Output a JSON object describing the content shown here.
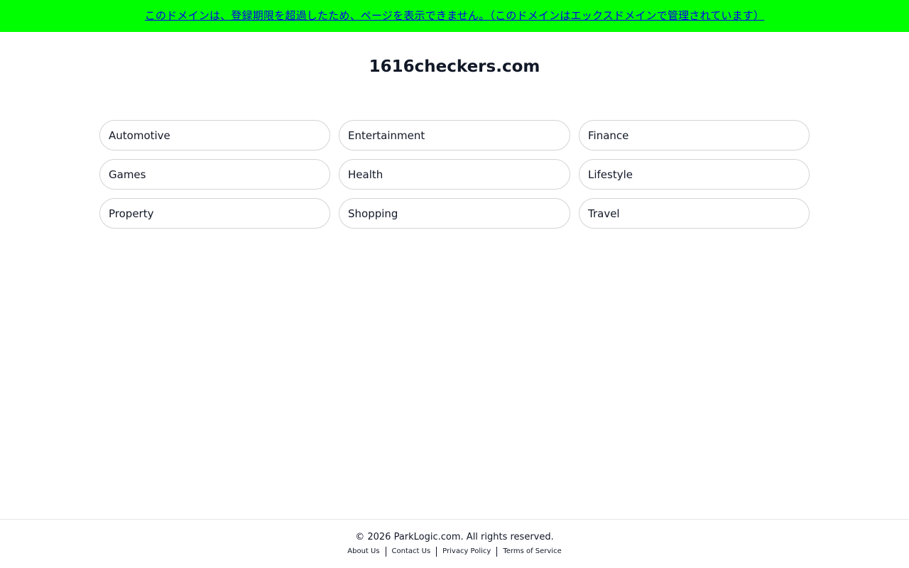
{
  "banner": {
    "text": "このドメインは、登録期限を超過したため、ページを表示できません。（このドメインはエックスドメインで管理されています）",
    "background": "#00ff00",
    "link_color": "#0000ee"
  },
  "site": {
    "title": "1616checkers.com"
  },
  "categories": [
    "Automotive",
    "Entertainment",
    "Finance",
    "Games",
    "Health",
    "Lifestyle",
    "Property",
    "Shopping",
    "Travel"
  ],
  "footer": {
    "copyright": "© 2026 ParkLogic.com. All rights reserved.",
    "links": {
      "about": "About Us",
      "contact": "Contact Us",
      "privacy": "Privacy Policy",
      "terms": "Terms of Service"
    }
  }
}
